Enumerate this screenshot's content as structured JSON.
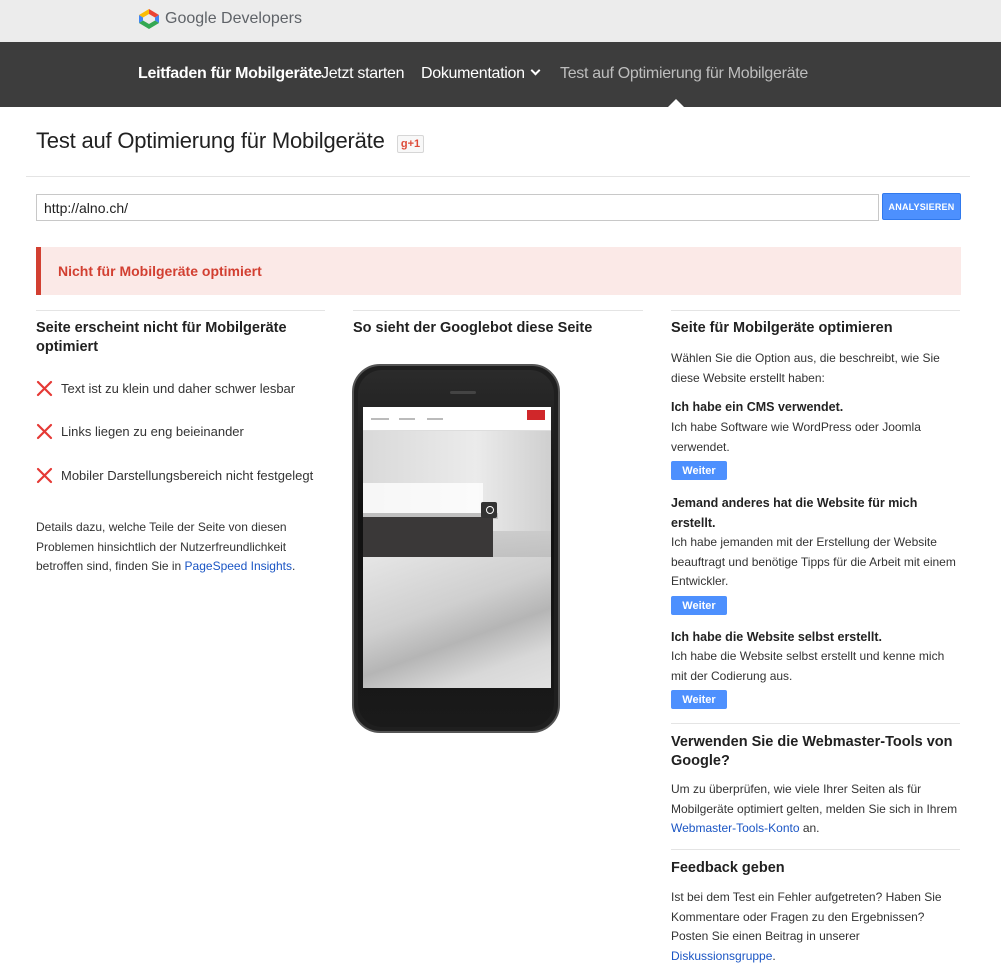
{
  "header": {
    "logo_text": "Google Developers"
  },
  "nav": {
    "items": [
      {
        "label": "Leitfaden für Mobilgeräte"
      },
      {
        "label": "Jetzt starten"
      },
      {
        "label": "Dokumentation"
      },
      {
        "label": "Test auf Optimierung für Mobilgeräte"
      }
    ]
  },
  "page": {
    "title": "Test auf Optimierung für Mobilgeräte",
    "gplus_label": "g+1"
  },
  "search": {
    "url_value": "http://alno.ch/",
    "analyze_label": "ANALYSIEREN"
  },
  "alert": {
    "text": "Nicht für Mobilgeräte optimiert"
  },
  "left": {
    "heading": "Seite erscheint nicht für Mobilgeräte optimiert",
    "issues": [
      {
        "text": "Text ist zu klein und daher schwer lesbar"
      },
      {
        "text": "Links liegen zu eng beieinander"
      },
      {
        "text": "Mobiler Darstellungsbereich nicht festgelegt"
      }
    ],
    "details_before": "Details dazu, welche Teile der Seite von diesen Problemen hinsichtlich der Nutzerfreundlichkeit betroffen sind, finden Sie in ",
    "details_link": "PageSpeed Insights",
    "details_after": "."
  },
  "middle": {
    "heading": "So sieht der Googlebot diese Seite"
  },
  "right": {
    "heading": "Seite für Mobilgeräte optimieren",
    "intro": "Wählen Sie die Option aus, die beschreibt, wie Sie diese Website erstellt haben:",
    "options": [
      {
        "title": "Ich habe ein CMS verwendet.",
        "desc": "Ich habe Software wie WordPress oder Joomla verwendet.",
        "button": "Weiter"
      },
      {
        "title": "Jemand anderes hat die Website für mich erstellt.",
        "desc": "Ich habe jemanden mit der Erstellung der Website beauftragt und benötige Tipps für die Arbeit mit einem Entwickler.",
        "button": "Weiter"
      },
      {
        "title": "Ich habe die Website selbst erstellt.",
        "desc": "Ich habe die Website selbst erstellt und kenne mich mit der Codierung aus.",
        "button": "Weiter"
      }
    ],
    "webmaster": {
      "heading": "Verwenden Sie die Webmaster-Tools von Google?",
      "text_before": "Um zu überprüfen, wie viele Ihrer Seiten als für Mobilgeräte optimiert gelten, melden Sie sich in Ihrem ",
      "link": "Webmaster-Tools-Konto",
      "text_after": " an."
    },
    "feedback": {
      "heading": "Feedback geben",
      "text_before": "Ist bei dem Test ein Fehler aufgetreten? Haben Sie Kommentare oder Fragen zu den Ergebnissen? Posten Sie einen Beitrag in unserer ",
      "link": "Diskussionsgruppe",
      "text_after": "."
    }
  },
  "colors": {
    "nav_bg": "#3d3d3d",
    "accent_blue": "#4d90fe",
    "error_red": "#d23f31",
    "alert_bg": "#fbe9e7",
    "link_blue": "#1a55c4"
  }
}
